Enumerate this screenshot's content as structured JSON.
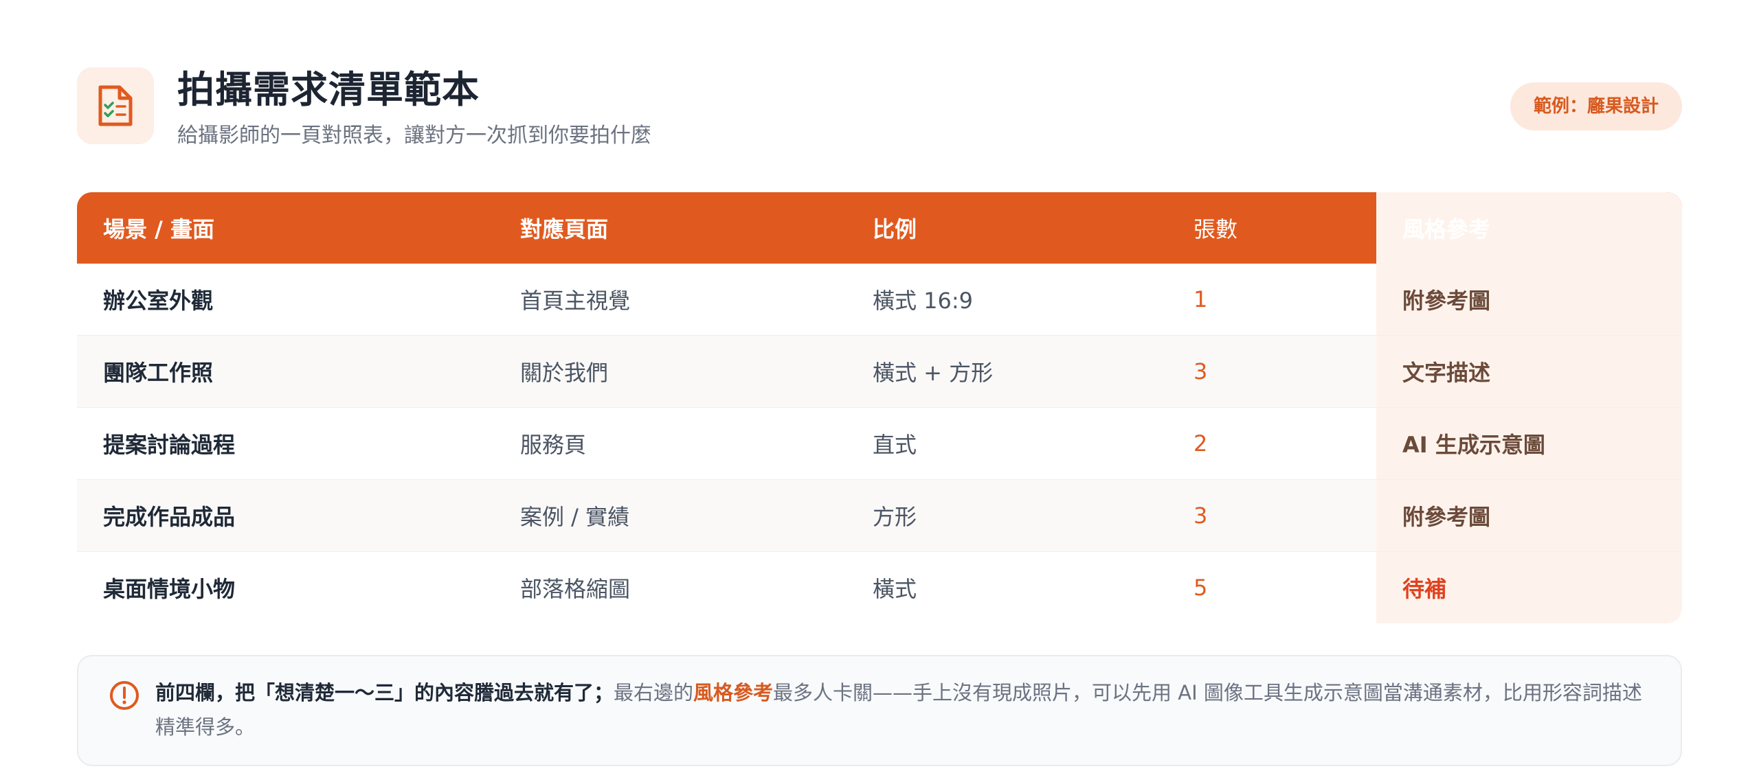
{
  "header": {
    "title": "拍攝需求清單範本",
    "subtitle": "給攝影師的一頁對照表，讓對方一次抓到你要拍什麼",
    "badge": "範例：廱果設計",
    "icon": "document-checklist-icon"
  },
  "table": {
    "columns": [
      "場景 / 畫面",
      "對應頁面",
      "比例",
      "張數",
      "風格參考"
    ],
    "rows": [
      [
        "辦公室外觀",
        "首頁主視覺",
        "橫式 16:9",
        "1",
        "附參考圖"
      ],
      [
        "團隊工作照",
        "關於我們",
        "橫式 + 方形",
        "3",
        "文字描述"
      ],
      [
        "提案討論過程",
        "服務頁",
        "直式",
        "2",
        "AI 生成示意圖"
      ],
      [
        "完成作品成品",
        "案例 / 實績",
        "方形",
        "3",
        "附參考圖"
      ],
      [
        "桌面情境小物",
        "部落格縮圖",
        "橫式",
        "5",
        "待補"
      ]
    ]
  },
  "note": {
    "icon": "alert-circle-icon",
    "bold": "前四欄，把「想清楚一～三」的內容謄過去就有了；",
    "text1": "最右邊的",
    "accent": "風格參考",
    "text2": "最多人卡關——手上沒有現成照片，可以先用 AI 圖像工具生成示意圖當溝通素材，比用形容詞描述精準得多。"
  },
  "colors": {
    "accent": "#e05a1f",
    "accent_dark": "#c2440f",
    "accent_light": "#fdeee6",
    "pending": "#e0421f"
  }
}
